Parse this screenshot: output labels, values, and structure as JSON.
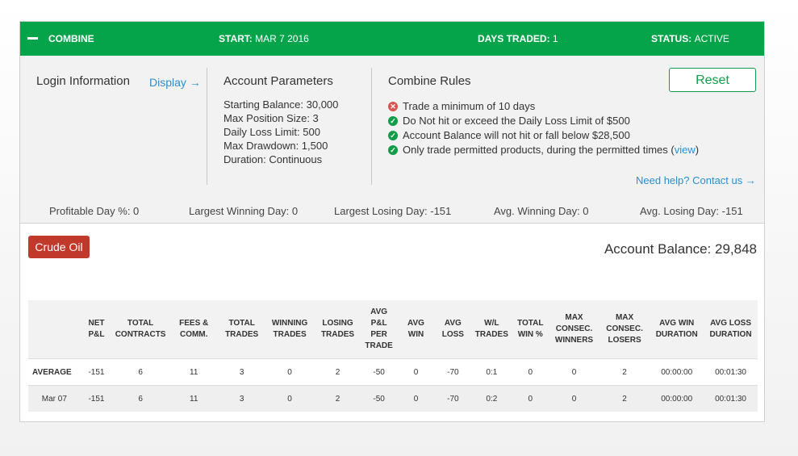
{
  "header": {
    "title": "COMBINE",
    "start_label": "START:",
    "start_value": "MAR 7 2016",
    "days_label": "DAYS TRADED:",
    "days_value": "1",
    "status_label": "STATUS:",
    "status_value": "ACTIVE",
    "color": "#05a34a"
  },
  "login": {
    "title": "Login Information",
    "display_link": "Display →"
  },
  "params": {
    "title": "Account Parameters",
    "lines": [
      "Starting Balance: 30,000",
      "Max Position Size: 3",
      "Daily Loss Limit: 500",
      "Max Drawdown: 1,500",
      "Duration: Continuous"
    ]
  },
  "rules": {
    "title": "Combine Rules",
    "reset_label": "Reset",
    "items": [
      {
        "status": "fail",
        "text": "Trade a minimum of 10 days"
      },
      {
        "status": "pass",
        "text": "Do Not hit or exceed the Daily Loss Limit of $500"
      },
      {
        "status": "pass",
        "text": "Account Balance will not hit or fall below $28,500"
      },
      {
        "status": "pass",
        "text": "Only trade permitted products, during the permitted times (",
        "link": "view",
        "suffix": ")"
      }
    ],
    "help_link": "Need help? Contact us →"
  },
  "stats": {
    "profitable": "Profitable Day %: 0",
    "largest_win": "Largest Winning Day: 0",
    "largest_loss": "Largest Losing Day: -151",
    "avg_win": "Avg. Winning Day: 0",
    "avg_loss": "Avg. Losing Day: -151"
  },
  "product_button": "Crude Oil",
  "account_balance": "Account Balance: 29,848",
  "table": {
    "columns": [
      "",
      "NET P&L",
      "TOTAL CONTRACTS",
      "FEES & COMM.",
      "TOTAL TRADES",
      "WINNING TRADES",
      "LOSING TRADES",
      "AVG P&L PER TRADE",
      "AVG WIN",
      "AVG LOSS",
      "W/L TRADES",
      "TOTAL WIN %",
      "MAX CONSEC. WINNERS",
      "MAX CONSEC. LOSERS",
      "AVG WIN DURATION",
      "AVG LOSS DURATION"
    ],
    "rows": [
      [
        "AVERAGE",
        "-151",
        "6",
        "11",
        "3",
        "0",
        "2",
        "-50",
        "0",
        "-70",
        "0:1",
        "0",
        "0",
        "2",
        "00:00:00",
        "00:01:30"
      ],
      [
        "Mar 07",
        "-151",
        "6",
        "11",
        "3",
        "0",
        "2",
        "-50",
        "0",
        "-70",
        "0:2",
        "0",
        "0",
        "2",
        "00:00:00",
        "00:01:30"
      ]
    ]
  }
}
